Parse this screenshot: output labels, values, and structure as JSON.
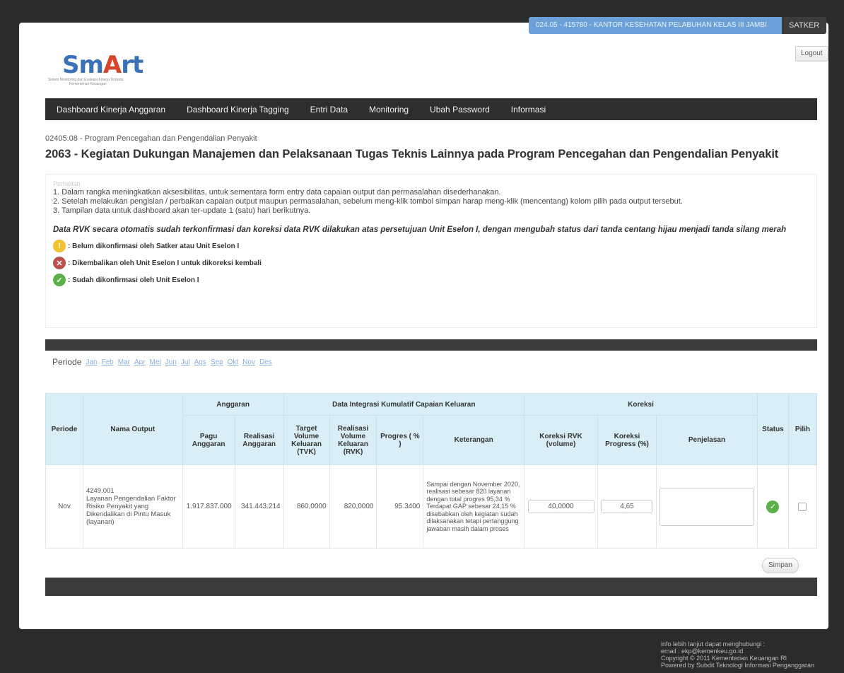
{
  "header": {
    "satker_name": "024.05 - 415780 - KANTOR KESEHATAN PELABUHAN KELAS III JAMBI",
    "satker_label": "SATKER",
    "logout_label": "Logout"
  },
  "logo": {
    "text_sm": "Sm",
    "text_a": "A",
    "text_rt": "rt",
    "tagline": "Sistem Monitoring dan Evaluasi Kinerja Terpadu",
    "tagline2": "Kementerian Keuangan"
  },
  "nav": [
    "Dashboard Kinerja Anggaran",
    "Dashboard Kinerja Tagging",
    "Entri Data",
    "Monitoring",
    "Ubah Password",
    "Informasi"
  ],
  "program": "02405.08 - Program Pencegahan dan Pengendalian Penyakit",
  "activity": "2063 - Kegiatan Dukungan Manajemen dan Pelaksanaan Tugas Teknis Lainnya pada Program Pencegahan dan Pengendalian Penyakit",
  "notes": {
    "heading": "Perhatian",
    "items": [
      "1. Dalam rangka meningkatkan aksesibilitas, untuk sementara form entry data capaian output dan permasalahan disederhanakan.",
      "2. Setelah melakukan pengisian / perbaikan capaian output maupun permasalahan, sebelum meng-klik tombol simpan harap meng-klik (mencentang) kolom pilih pada output tersebut.",
      "3. Tampilan data untuk dashboard akan ter-update 1 (satu) hari berikutnya."
    ],
    "emphasis": "Data RVK secara otomatis sudah terkonfirmasi dan koreksi data RVK dilakukan atas persetujuan Unit Eselon I, dengan mengubah status dari tanda centang hijau menjadi tanda silang merah",
    "legend": [
      {
        "icon": "warning-icon",
        "text": ": Belum dikonfirmasi oleh Satker atau Unit Eselon I",
        "color": "#f2c12e"
      },
      {
        "icon": "cross-icon",
        "text": ": Dikembalikan oleh Unit Eselon I untuk dikoreksi kembali",
        "color": "#c0504d"
      },
      {
        "icon": "check-icon",
        "text": ": Sudah dikonfirmasi oleh Unit Eselon I",
        "color": "#5bb146"
      }
    ]
  },
  "periode": {
    "label": "Periode",
    "months": [
      "Jan",
      "Feb",
      "Mar",
      "Apr",
      "Mei",
      "Jun",
      "Jul",
      "Ags",
      "Sep",
      "Okt",
      "Nov",
      "Des"
    ]
  },
  "table": {
    "group_headers": {
      "anggaran": "Anggaran",
      "data_integrasi": "Data Integrasi Kumulatif Capaian Keluaran",
      "koreksi": "Koreksi"
    },
    "headers": {
      "periode": "Periode",
      "nama_output": "Nama Output",
      "pagu": "Pagu Anggaran",
      "realisasi": "Realisasi Anggaran",
      "tvk": "Target Volume Keluaran (TVK)",
      "rvk": "Realisasi Volume Keluaran (RVK)",
      "progres": "Progres ( % )",
      "keterangan": "Keterangan",
      "koreksi_rvk": "Koreksi RVK (volume)",
      "koreksi_progress": "Koreksi Progress (%)",
      "penjelasan": "Penjelasan",
      "status": "Status",
      "pilih": "Pilih"
    },
    "row": {
      "periode": "Nov",
      "output_code": "4249.001",
      "output_name": "Layanan Pengendalian Faktor Risiko Penyakit yang Dikendalikan di Pintu Masuk",
      "output_unit": "(layanan)",
      "pagu": "1.917.837.000",
      "realisasi": "341.443.214",
      "tvk": "860,0000",
      "rvk": "820,0000",
      "progres": "95.3400",
      "keterangan": "Sampai dengan November 2020, realisasi sebesar 820 layanan dengan total progres 95,34 % Terdapat GAP sebesar 24,15 % disebabkan oleh kegiatan sudah dilaksanakan tetapi pertanggung jawaban masih dalam proses",
      "koreksi_rvk": "40,0000",
      "koreksi_progress": "4,65",
      "penjelasan": "",
      "status": "check-icon"
    }
  },
  "save_label": "Simpan",
  "footer": [
    "info lebih lanjut dapat menghubungi :",
    "email : ekp@kemenkeu.go.id",
    "Copyright © 2011 Kementerian Keuangan RI",
    "Powered by Subdit Teknologi Informasi Penganggaran"
  ]
}
